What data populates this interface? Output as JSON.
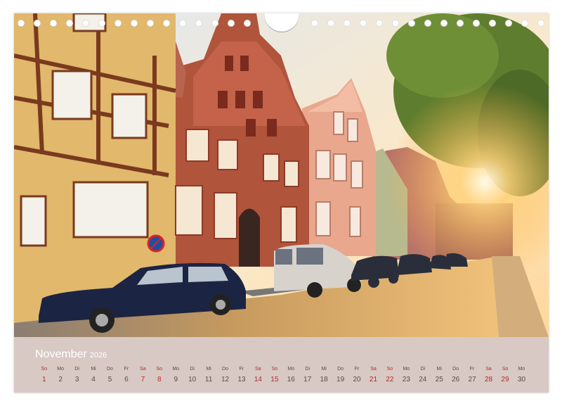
{
  "calendar": {
    "month": "November",
    "year": "2026",
    "days": [
      {
        "name": "So",
        "num": "1",
        "weekend": true
      },
      {
        "name": "Mo",
        "num": "2",
        "weekend": false
      },
      {
        "name": "Di",
        "num": "3",
        "weekend": false
      },
      {
        "name": "Mi",
        "num": "4",
        "weekend": false
      },
      {
        "name": "Do",
        "num": "5",
        "weekend": false
      },
      {
        "name": "Fr",
        "num": "6",
        "weekend": false
      },
      {
        "name": "Sa",
        "num": "7",
        "weekend": true
      },
      {
        "name": "So",
        "num": "8",
        "weekend": true
      },
      {
        "name": "Mo",
        "num": "9",
        "weekend": false
      },
      {
        "name": "Di",
        "num": "10",
        "weekend": false
      },
      {
        "name": "Mi",
        "num": "11",
        "weekend": false
      },
      {
        "name": "Do",
        "num": "12",
        "weekend": false
      },
      {
        "name": "Fr",
        "num": "13",
        "weekend": false
      },
      {
        "name": "Sa",
        "num": "14",
        "weekend": true
      },
      {
        "name": "So",
        "num": "15",
        "weekend": true
      },
      {
        "name": "Mo",
        "num": "16",
        "weekend": false
      },
      {
        "name": "Di",
        "num": "17",
        "weekend": false
      },
      {
        "name": "Mi",
        "num": "18",
        "weekend": false
      },
      {
        "name": "Do",
        "num": "19",
        "weekend": false
      },
      {
        "name": "Fr",
        "num": "20",
        "weekend": false
      },
      {
        "name": "Sa",
        "num": "21",
        "weekend": true
      },
      {
        "name": "So",
        "num": "22",
        "weekend": true
      },
      {
        "name": "Mo",
        "num": "23",
        "weekend": false
      },
      {
        "name": "Di",
        "num": "24",
        "weekend": false
      },
      {
        "name": "Mi",
        "num": "25",
        "weekend": false
      },
      {
        "name": "Do",
        "num": "26",
        "weekend": false
      },
      {
        "name": "Fr",
        "num": "27",
        "weekend": false
      },
      {
        "name": "Sa",
        "num": "28",
        "weekend": true
      },
      {
        "name": "So",
        "num": "29",
        "weekend": true
      },
      {
        "name": "Mo",
        "num": "30",
        "weekend": false
      }
    ]
  },
  "colors": {
    "strip": "#d8c9c4",
    "weekday_text": "#5a4a44",
    "weekend_text": "#b52a2a"
  }
}
